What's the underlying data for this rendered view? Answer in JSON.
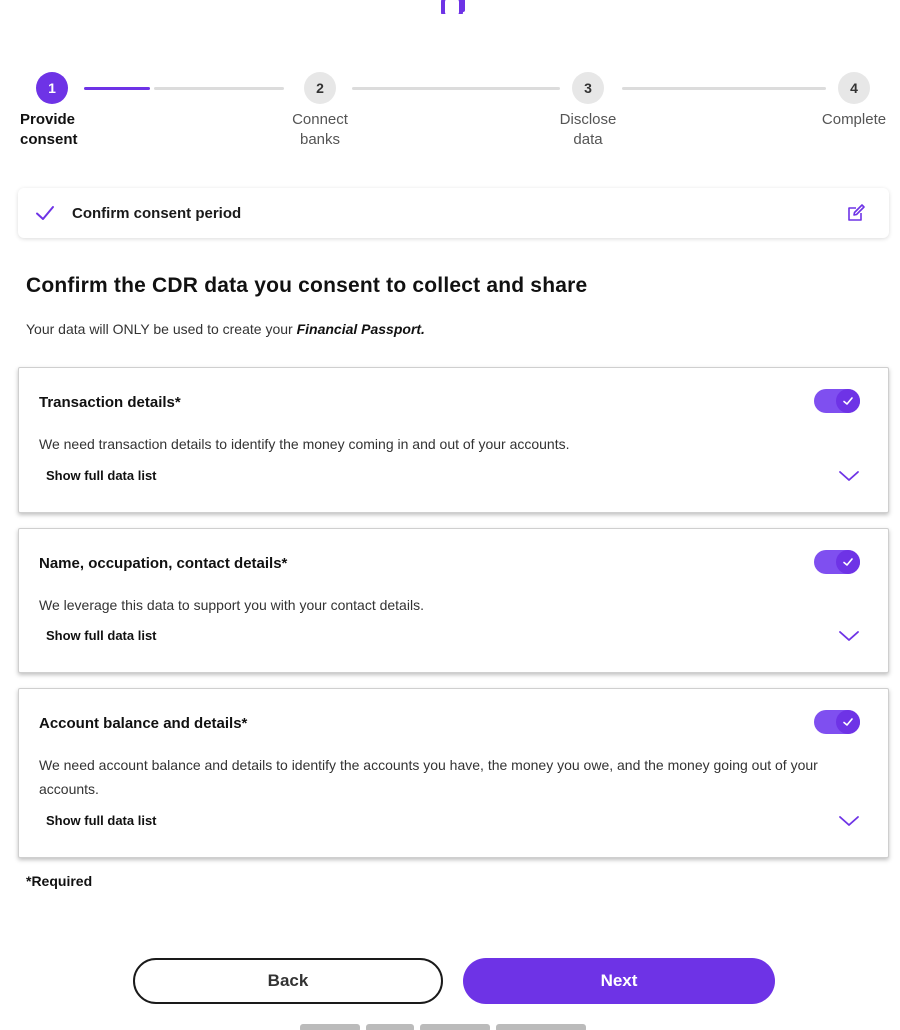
{
  "stepper": {
    "steps": [
      {
        "number": "1",
        "label": "Provide\nconsent",
        "active": true
      },
      {
        "number": "2",
        "label": "Connect\nbanks",
        "active": false
      },
      {
        "number": "3",
        "label": "Disclose\ndata",
        "active": false
      },
      {
        "number": "4",
        "label": "Complete",
        "active": false
      }
    ]
  },
  "consent_period": {
    "label": "Confirm consent period"
  },
  "section": {
    "title": "Confirm the CDR data you consent to collect and share",
    "subtitle_prefix": "Your data will ONLY be used to create your ",
    "subtitle_emphasis": "Financial Passport."
  },
  "data_items": [
    {
      "title": "Transaction details*",
      "description": "We need transaction details to identify the money coming in and out of your accounts.",
      "show_label": "Show full data list",
      "enabled": true
    },
    {
      "title": "Name, occupation, contact details*",
      "description": "We leverage this data to support you with your contact details.",
      "show_label": "Show full data list",
      "enabled": true
    },
    {
      "title": "Account balance and details*",
      "description": "We need account balance and details to identify the accounts you have, the money you owe, and the money going out of your accounts.",
      "show_label": "Show full data list",
      "enabled": true
    }
  ],
  "required_note": "*Required",
  "buttons": {
    "back": "Back",
    "next": "Next"
  },
  "colors": {
    "accent": "#6e33e6",
    "toggle_track": "#7f4ff0",
    "inactive_step": "#e7e7e7"
  }
}
